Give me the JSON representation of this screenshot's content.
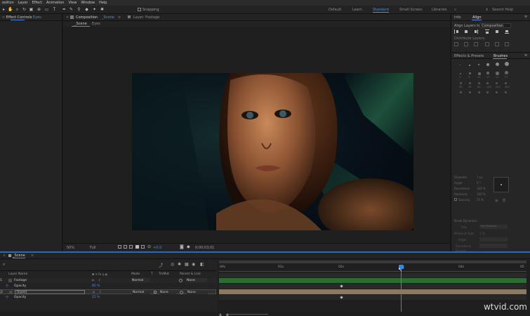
{
  "menu": [
    "osition",
    "Layer",
    "Effect",
    "Animation",
    "View",
    "Window",
    "Help"
  ],
  "toolbar": {
    "snapping_label": "Snapping",
    "workspaces": [
      "Default",
      "Learn",
      "Standard",
      "Small Screen",
      "Libraries"
    ],
    "active_workspace": "Standard",
    "search_placeholder": "Search Help"
  },
  "left_panel": {
    "tab_label": "Effect Controls",
    "tab_target": "Eyes"
  },
  "comp_panel": {
    "tab_composition": "Composition",
    "tab_comp_name": "_Scene",
    "tab_layer": "Layer: Footage",
    "sub_tabs": [
      "_Scene",
      "Eyes"
    ],
    "footer": {
      "zoom": "50%",
      "resolution": "Full",
      "plus_value": "+0.0",
      "timecode": "0;00;03;01"
    }
  },
  "right_panel": {
    "tabs": [
      "Info",
      "Align"
    ],
    "active_tab": "Align",
    "align_to_label": "Align Layers to:",
    "align_to_value": "Composition",
    "distribute_label": "Distribute Layers:",
    "effects_tab": "Effects & Presets",
    "brushes_tab": "Brushes",
    "brush_sizes": [
      "1",
      "3",
      "5",
      "9",
      "13",
      "19",
      "5",
      "9",
      "13",
      "17",
      "21",
      "27",
      "35",
      "45",
      "65",
      "100",
      "200",
      "300"
    ],
    "brush_props": [
      "Diameter",
      "Angle",
      "Roundness",
      "Hardness",
      "Spacing"
    ],
    "brush_values": [
      "7 px",
      "0 °",
      "100 %",
      "100 %",
      "25 %"
    ],
    "brush_dynamics": "Brush Dynamics",
    "dyn_size": "Size",
    "dyn_min_size": "Minimum Size",
    "dyn_angle": "Angle",
    "dyn_roundness": "Roundness",
    "dyn_opacity": "Opacity",
    "dyn_flow": "Flow",
    "dyn_value": "Pen Pressure",
    "min_size_value": "1 %"
  },
  "timeline": {
    "tab_label": "_Scene",
    "columns": {
      "layer_name": "Layer Name",
      "mode": "Mode",
      "t": "T",
      "trkmat": "TrkMat",
      "parent": "Parent & Link"
    },
    "layers": [
      {
        "num": "1",
        "name": "Footage",
        "mode": "Normal",
        "trkmat": "",
        "parent": "None",
        "property": "Opacity",
        "prop_value": "80 %"
      },
      {
        "num": "2",
        "name": "[Eyes]",
        "mode": "Normal",
        "trkmat": "None",
        "parent": "None",
        "property": "Opacity",
        "prop_value": "25 %"
      }
    ],
    "ruler": [
      "00s",
      "01s",
      "02s",
      "03s",
      "04s",
      "05"
    ],
    "playhead_label": "03s"
  },
  "watermark": "wtvid.com",
  "colors": {
    "accent": "#2d8ceb",
    "active_workspace": "#4e8fe0",
    "track_green": "#2c6b34",
    "track_tan": "#8a7a63"
  }
}
